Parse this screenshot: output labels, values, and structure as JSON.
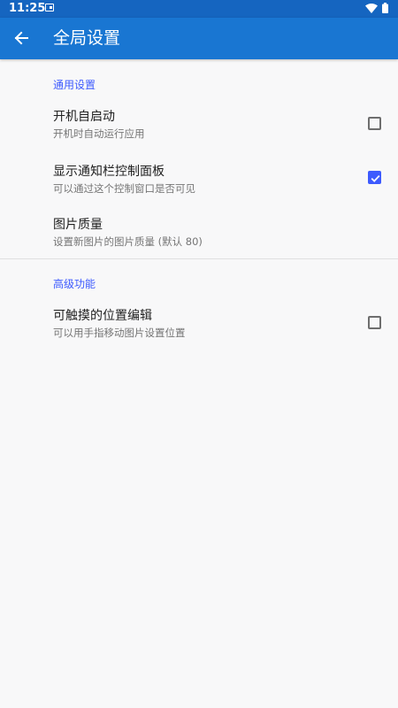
{
  "status_bar": {
    "time": "11:25",
    "icons": [
      "notification-icon",
      "wifi-icon",
      "battery-icon"
    ]
  },
  "app_bar": {
    "title": "全局设置",
    "back_icon": "arrow-back-icon"
  },
  "sections": [
    {
      "header": "通用设置",
      "items": [
        {
          "title": "开机自启动",
          "summary": "开机时自动运行应用",
          "checked": false
        },
        {
          "title": "显示通知栏控制面板",
          "summary": "可以通过这个控制窗口是否可见",
          "checked": true
        },
        {
          "title": "图片质量",
          "summary": "设置新图片的图片质量 (默认 80)"
        }
      ]
    },
    {
      "header": "高级功能",
      "items": [
        {
          "title": "可触摸的位置编辑",
          "summary": "可以用手指移动图片设置位置",
          "checked": false
        }
      ]
    }
  ],
  "colors": {
    "status_bar": "#1565c0",
    "app_bar": "#1976d2",
    "accent": "#3d5afe",
    "background": "#f8f8f9"
  }
}
